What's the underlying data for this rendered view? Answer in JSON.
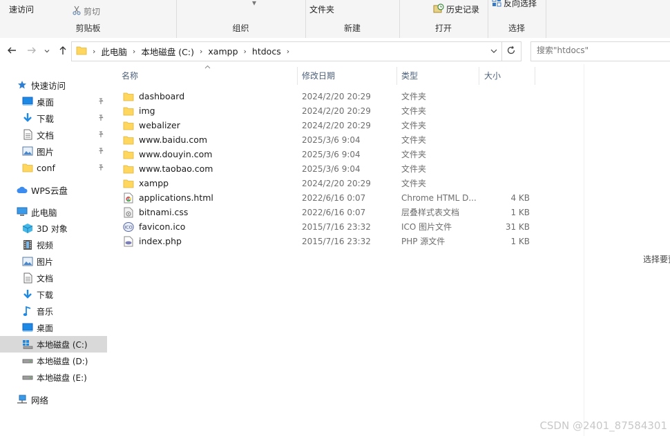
{
  "ribbon": {
    "quick_access_label": "速访问",
    "clip_left": "...",
    "cut_label": "剪切",
    "clipboard_group": "剪贴板",
    "organize_group": "组织",
    "folder_label": "文件夹",
    "new_group": "新建",
    "history_label": "历史记录",
    "open_group": "打开",
    "invert_selection_label": "反向选择",
    "select_group": "选择"
  },
  "address": {
    "crumbs": [
      "此电脑",
      "本地磁盘 (C:)",
      "xampp",
      "htdocs"
    ]
  },
  "search": {
    "placeholder": "搜索\"htdocs\""
  },
  "navigation": {
    "quick_access": "快速访问",
    "pinned": [
      {
        "label": "桌面",
        "icon": "desktop-icon"
      },
      {
        "label": "下载",
        "icon": "download-icon"
      },
      {
        "label": "文档",
        "icon": "document-icon"
      },
      {
        "label": "图片",
        "icon": "picture-icon"
      },
      {
        "label": "conf",
        "icon": "folder-icon"
      }
    ],
    "wps_cloud": "WPS云盘",
    "this_pc": "此电脑",
    "pc_items": [
      {
        "label": "3D 对象",
        "icon": "3d-objects-icon"
      },
      {
        "label": "视频",
        "icon": "video-icon"
      },
      {
        "label": "图片",
        "icon": "picture-icon"
      },
      {
        "label": "文档",
        "icon": "document-icon"
      },
      {
        "label": "下载",
        "icon": "download-icon"
      },
      {
        "label": "音乐",
        "icon": "music-icon"
      },
      {
        "label": "桌面",
        "icon": "desktop-icon"
      },
      {
        "label": "本地磁盘 (C:)",
        "icon": "windows-drive-icon"
      },
      {
        "label": "本地磁盘 (D:)",
        "icon": "drive-icon"
      },
      {
        "label": "本地磁盘 (E:)",
        "icon": "drive-icon"
      }
    ],
    "network": "网络",
    "selected": "本地磁盘 (C:)"
  },
  "columns": {
    "name": "名称",
    "date": "修改日期",
    "type": "类型",
    "size": "大小"
  },
  "files": [
    {
      "name": "dashboard",
      "date": "2024/2/20 20:29",
      "type": "文件夹",
      "size": "",
      "icon": "folder-icon"
    },
    {
      "name": "img",
      "date": "2024/2/20 20:29",
      "type": "文件夹",
      "size": "",
      "icon": "folder-icon"
    },
    {
      "name": "webalizer",
      "date": "2024/2/20 20:29",
      "type": "文件夹",
      "size": "",
      "icon": "folder-icon"
    },
    {
      "name": "www.baidu.com",
      "date": "2025/3/6 9:04",
      "type": "文件夹",
      "size": "",
      "icon": "folder-icon"
    },
    {
      "name": "www.douyin.com",
      "date": "2025/3/6 9:04",
      "type": "文件夹",
      "size": "",
      "icon": "folder-icon"
    },
    {
      "name": "www.taobao.com",
      "date": "2025/3/6 9:04",
      "type": "文件夹",
      "size": "",
      "icon": "folder-icon"
    },
    {
      "name": "xampp",
      "date": "2024/2/20 20:29",
      "type": "文件夹",
      "size": "",
      "icon": "folder-icon"
    },
    {
      "name": "applications.html",
      "date": "2022/6/16 0:07",
      "type": "Chrome HTML D...",
      "size": "4 KB",
      "icon": "chrome-html-icon"
    },
    {
      "name": "bitnami.css",
      "date": "2022/6/16 0:07",
      "type": "层叠样式表文档",
      "size": "1 KB",
      "icon": "css-file-icon"
    },
    {
      "name": "favicon.ico",
      "date": "2015/7/16 23:32",
      "type": "ICO 图片文件",
      "size": "31 KB",
      "icon": "ico-file-icon"
    },
    {
      "name": "index.php",
      "date": "2015/7/16 23:32",
      "type": "PHP 源文件",
      "size": "1 KB",
      "icon": "php-file-icon"
    }
  ],
  "preview": {
    "message": "选择要预览的文件。"
  },
  "watermark": "CSDN @2401_87584301",
  "colors": {
    "folder": "#ffd75e",
    "accent": "#0078d4",
    "selected_bg": "#d9d9d9",
    "column_header_text": "#4c607a"
  }
}
